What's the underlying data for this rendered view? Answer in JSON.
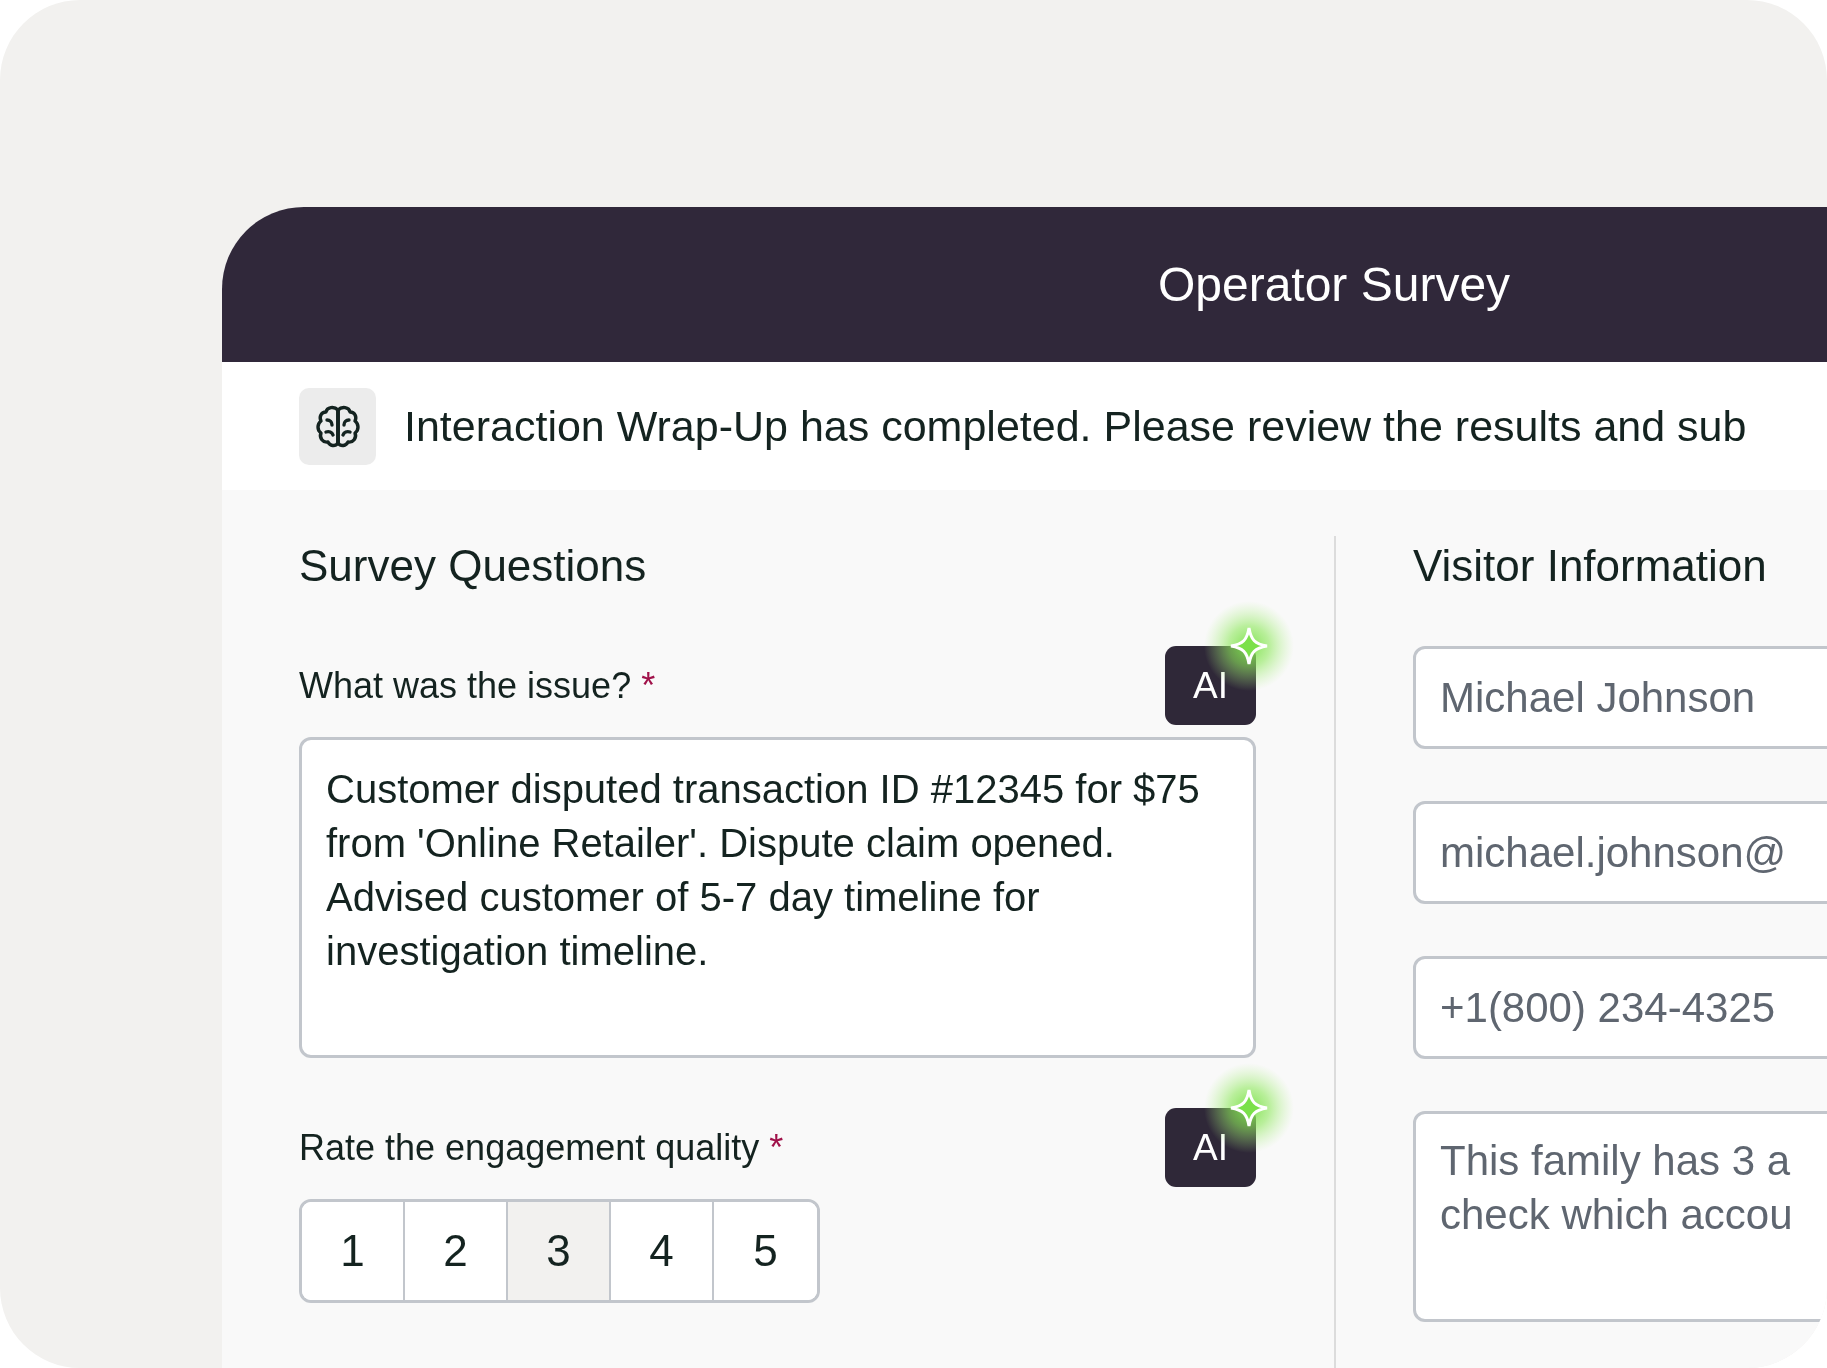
{
  "window": {
    "title": "Operator Survey"
  },
  "banner": {
    "text": "Interaction Wrap-Up has completed. Please review the results and sub"
  },
  "survey": {
    "title": "Survey Questions",
    "questions": [
      {
        "kind": "text",
        "label": "What was the issue?",
        "required_mark": "*",
        "ai_button": "AI",
        "value": "Customer disputed transaction ID #12345 for $75 from 'Online Retailer'. Dispute claim opened. Advised customer of 5-7 day timeline for investigation timeline."
      },
      {
        "kind": "rating",
        "label": "Rate the engagement quality",
        "required_mark": "*",
        "ai_button": "AI",
        "options": [
          {
            "label": "1",
            "selected": false
          },
          {
            "label": "2",
            "selected": false
          },
          {
            "label": "3",
            "selected": true
          },
          {
            "label": "4",
            "selected": false
          },
          {
            "label": "5",
            "selected": false
          }
        ]
      }
    ]
  },
  "visitor": {
    "title": "Visitor Information",
    "fields": [
      {
        "kind": "name",
        "lines": [
          "Michael Johnson"
        ]
      },
      {
        "kind": "email",
        "lines": [
          "michael.johnson@"
        ]
      },
      {
        "kind": "phone",
        "lines": [
          "+1(800) 234-4325"
        ]
      },
      {
        "kind": "notes",
        "lines": [
          "This family has 3 a",
          "check which accou"
        ]
      }
    ]
  }
}
